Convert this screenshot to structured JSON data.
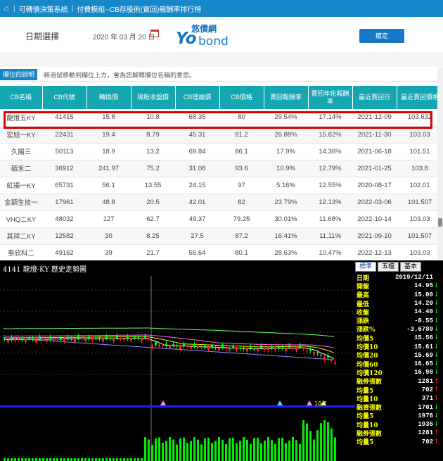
{
  "nav": {
    "items": [
      "可轉債決策系統",
      "付費模組--CB存股術(賣回)報酬率排行榜"
    ]
  },
  "datebar": {
    "label": "日期選擇",
    "value": "2020 年 03 月 20 日",
    "confirm": "確定"
  },
  "logo": {
    "cn": "悠債網",
    "yo": "Yo",
    "bond": "bond"
  },
  "hint": {
    "tag": "欄位的說明",
    "text": "將滑鼠移動到欄位上方，會為您解釋欄位名稱的意思。"
  },
  "table": {
    "headers": [
      "CB名稱",
      "CB代號",
      "轉換價",
      "現股收盤價",
      "CB理論價",
      "CB價格",
      "賣回報酬率",
      "賣回年化報酬率",
      "最近賣回日",
      "最近賣回價格"
    ],
    "rows": [
      [
        "龍燈五KY",
        "41415",
        "15.8",
        "10.8",
        "68.35",
        "80",
        "29.54%",
        "17.14%",
        "2021-12-09",
        "103.632"
      ],
      [
        "宏旭一KY",
        "22431",
        "19.4",
        "8.79",
        "45.31",
        "81.2",
        "26.88%",
        "15.82%",
        "2021-11-30",
        "103.03"
      ],
      [
        "久陽三",
        "50113",
        "18.9",
        "13.2",
        "69.84",
        "86.1",
        "17.9%",
        "14.36%",
        "2021-06-18",
        "101.51"
      ],
      [
        "碩禾二",
        "36912",
        "241.97",
        "75.2",
        "31.08",
        "93.6",
        "10.9%",
        "12.79%",
        "2021-01-25",
        "103.8"
      ],
      [
        "虹揚一KY",
        "65731",
        "56.1",
        "13.55",
        "24.15",
        "97",
        "5.16%",
        "12.55%",
        "2020-08-17",
        "102.01"
      ],
      [
        "金穎生技一",
        "17961",
        "48.8",
        "20.5",
        "42.01",
        "82",
        "23.79%",
        "12.13%",
        "2022-03-06",
        "101.507"
      ],
      [
        "VHQ二KY",
        "48032",
        "127",
        "62.7",
        "49.37",
        "79.25",
        "30.01%",
        "11.68%",
        "2022-10-14",
        "103.03"
      ],
      [
        "其祥二KY",
        "12582",
        "30",
        "8.25",
        "27.5",
        "87.2",
        "16.41%",
        "11.11%",
        "2021-09-10",
        "101.507"
      ],
      [
        "事欣科二",
        "49162",
        "39",
        "21.7",
        "55.64",
        "80.1",
        "28.63%",
        "10.47%",
        "2022-12-13",
        "103.03"
      ]
    ]
  },
  "chart": {
    "title": "4141 龍燈-KY  歷史走勢圖",
    "tabs": [
      "標準",
      "五檔",
      "基本"
    ],
    "marker_label": "10.7"
  },
  "panel": {
    "rows": [
      {
        "k": "日期",
        "v": "2019/12/11",
        "arrow": "",
        "color": "#ffffff"
      },
      {
        "k": "開盤",
        "v": "14.95",
        "arrow": "↓",
        "color": "#00ff00"
      },
      {
        "k": "最高",
        "v": "15.00",
        "arrow": "↓",
        "color": "#00ff00"
      },
      {
        "k": "最低",
        "v": "14.20",
        "arrow": "↓",
        "color": "#00ff00"
      },
      {
        "k": "收盤",
        "v": "14.40",
        "arrow": "↓",
        "color": "#00ff00"
      },
      {
        "k": "漲跌",
        "v": "-0.55",
        "arrow": "↓",
        "color": "#00ff00"
      },
      {
        "k": "漲跌%",
        "v": "-3.6789",
        "arrow": "↓",
        "color": "#00ff00"
      },
      {
        "k": "均價5",
        "v": "15.56",
        "arrow": "↓",
        "color": "#00ff00"
      },
      {
        "k": "均價10",
        "v": "15.61",
        "arrow": "↓",
        "color": "#00ff00"
      },
      {
        "k": "均價20",
        "v": "15.69",
        "arrow": "↓",
        "color": "#00ff00"
      },
      {
        "k": "均價60",
        "v": "16.65",
        "arrow": "↓",
        "color": "#00ff00"
      },
      {
        "k": "均價120",
        "v": "16.98",
        "arrow": "↓",
        "color": "#00ff00"
      },
      {
        "k": "融券張數",
        "v": "1281",
        "arrow": "↑",
        "color": "#ff2020"
      },
      {
        "k": "均量5",
        "v": "702",
        "arrow": "↑",
        "color": "#ff2020"
      },
      {
        "k": "均量10",
        "v": "371",
        "arrow": "↑",
        "color": "#ff2020"
      },
      {
        "k": "融資張數",
        "v": "1701",
        "arrow": "↓",
        "color": "#00ff00"
      },
      {
        "k": "均量5",
        "v": "1976",
        "arrow": "↓",
        "color": "#00ff00"
      },
      {
        "k": "均量10",
        "v": "1935",
        "arrow": "↓",
        "color": "#00ff00"
      },
      {
        "k": "融券張數",
        "v": "1281",
        "arrow": "↑",
        "color": "#ff2020"
      },
      {
        "k": "均量5",
        "v": "702",
        "arrow": "↑",
        "color": "#ff2020"
      }
    ]
  },
  "colors": {
    "nav": "#1688c9",
    "header": "#14a6b1",
    "highlight": "#e00000",
    "up": "#ff2020",
    "down": "#00ff00"
  }
}
